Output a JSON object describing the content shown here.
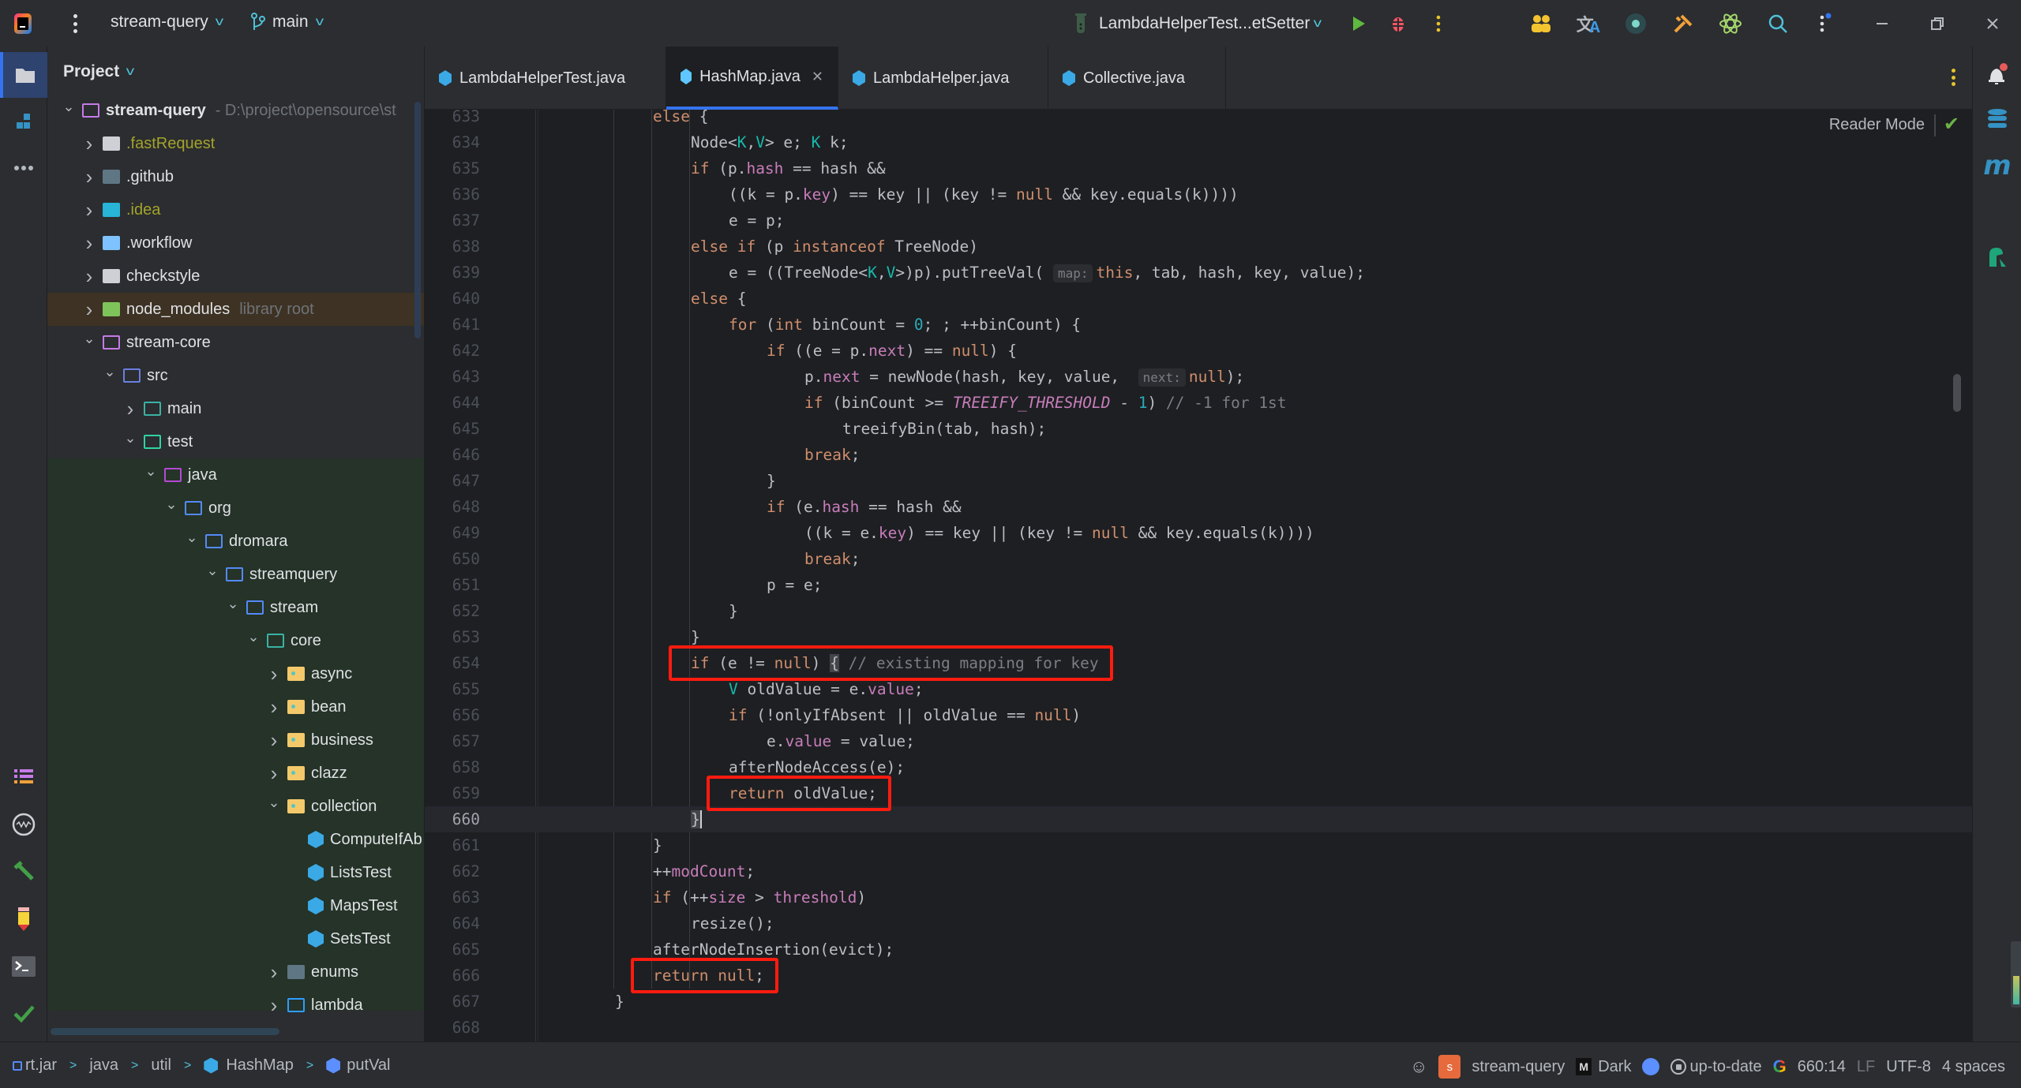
{
  "titlebar": {
    "project_name": "stream-query",
    "branch": "main",
    "run_config": "LambdaHelperTest...etSetter",
    "icons": [
      "app-logo-icon",
      "main-menu-icon",
      "run-icon",
      "debug-icon",
      "more-actions-icon",
      "code-with-me-icon",
      "translate-icon",
      "record-icon",
      "build-tools-icon",
      "ai-assistant-icon",
      "search-icon",
      "settings-more-icon",
      "minimize-icon",
      "restore-icon",
      "close-icon"
    ]
  },
  "left_toolbar": {
    "items": [
      {
        "name": "project-tool",
        "icon": "folder-icon",
        "active": true
      },
      {
        "name": "structure-tool",
        "icon": "structure-icon"
      },
      {
        "name": "more-tools",
        "icon": "more-horizontal-icon"
      },
      {
        "name": "todo-tool",
        "icon": "list-icon"
      },
      {
        "name": "profiler-tool",
        "icon": "waveform-icon"
      },
      {
        "name": "build-tool",
        "icon": "hammer-icon"
      },
      {
        "name": "notes-tool",
        "icon": "pencil-icon"
      },
      {
        "name": "terminal-tool",
        "icon": "terminal-icon"
      },
      {
        "name": "problems-tool",
        "icon": "check-icon"
      },
      {
        "name": "git-tool",
        "icon": "git-push-icon"
      }
    ]
  },
  "project_panel": {
    "title": "Project",
    "tree": [
      {
        "label": "stream-query",
        "hint": "- D:\\project\\opensource\\st",
        "depth": 0,
        "expanded": true,
        "icon": "module",
        "bold": true
      },
      {
        "label": ".fastRequest",
        "depth": 1,
        "expanded": false,
        "icon": "folder-solid",
        "olive": true
      },
      {
        "label": ".github",
        "depth": 1,
        "expanded": false,
        "icon": "folder-github"
      },
      {
        "label": ".idea",
        "depth": 1,
        "expanded": false,
        "icon": "folder-idea",
        "olive": true
      },
      {
        "label": ".workflow",
        "depth": 1,
        "expanded": false,
        "icon": "folder-workflow"
      },
      {
        "label": "checkstyle",
        "depth": 1,
        "expanded": false,
        "icon": "folder-solid"
      },
      {
        "label": "node_modules",
        "hint": "library root",
        "depth": 1,
        "expanded": false,
        "icon": "folder-node",
        "lib": true
      },
      {
        "label": "stream-core",
        "depth": 1,
        "expanded": true,
        "icon": "module"
      },
      {
        "label": "src",
        "depth": 2,
        "expanded": true,
        "icon": "folder-src"
      },
      {
        "label": "main",
        "depth": 3,
        "expanded": false,
        "icon": "folder-main"
      },
      {
        "label": "test",
        "depth": 3,
        "expanded": true,
        "icon": "folder-test"
      },
      {
        "label": "java",
        "depth": 4,
        "expanded": true,
        "icon": "folder-java"
      },
      {
        "label": "org",
        "depth": 5,
        "expanded": true,
        "icon": "package"
      },
      {
        "label": "dromara",
        "depth": 6,
        "expanded": true,
        "icon": "package"
      },
      {
        "label": "streamquery",
        "depth": 7,
        "expanded": true,
        "icon": "package"
      },
      {
        "label": "stream",
        "depth": 8,
        "expanded": true,
        "icon": "package"
      },
      {
        "label": "core",
        "depth": 9,
        "expanded": true,
        "icon": "folder-core"
      },
      {
        "label": "async",
        "depth": 10,
        "expanded": false,
        "icon": "package-yellow"
      },
      {
        "label": "bean",
        "depth": 10,
        "expanded": false,
        "icon": "package-yellow"
      },
      {
        "label": "business",
        "depth": 10,
        "expanded": false,
        "icon": "package-yellow"
      },
      {
        "label": "clazz",
        "depth": 10,
        "expanded": false,
        "icon": "package-yellow"
      },
      {
        "label": "collection",
        "depth": 10,
        "expanded": true,
        "icon": "package-yellow"
      },
      {
        "label": "ComputeIfAb",
        "depth": 11,
        "icon": "test-class"
      },
      {
        "label": "ListsTest",
        "depth": 11,
        "icon": "test-class"
      },
      {
        "label": "MapsTest",
        "depth": 11,
        "icon": "test-class"
      },
      {
        "label": "SetsTest",
        "depth": 11,
        "icon": "test-class"
      },
      {
        "label": "enums",
        "depth": 10,
        "expanded": false,
        "icon": "folder-enums"
      },
      {
        "label": "lambda",
        "depth": 10,
        "expanded": false,
        "icon": "folder-lambda"
      }
    ]
  },
  "editor": {
    "tabs": [
      {
        "label": "LambdaHelperTest.java",
        "active": false
      },
      {
        "label": "HashMap.java",
        "active": true,
        "closable": true
      },
      {
        "label": "LambdaHelper.java",
        "active": false
      },
      {
        "label": "Collective.java",
        "active": false
      }
    ],
    "reader_mode_label": "Reader Mode",
    "current_line": 660,
    "lines": [
      {
        "n": 633,
        "indent": 4,
        "html": "<span class='kw'>else</span> {"
      },
      {
        "n": 634,
        "indent": 5,
        "html": "Node&lt;<span class='tp'>K</span>,<span class='tp'>V</span>&gt; e; <span class='tp'>K</span> k;"
      },
      {
        "n": 635,
        "indent": 5,
        "html": "<span class='kw'>if</span> (p.<span class='fld'>hash</span> == hash &amp;&amp;"
      },
      {
        "n": 636,
        "indent": 6,
        "html": "((k = p.<span class='fld'>key</span>) == key || (key != <span class='kw'>null</span> &amp;&amp; key.equals(k))))"
      },
      {
        "n": 637,
        "indent": 6,
        "html": "e = p;"
      },
      {
        "n": 638,
        "indent": 5,
        "html": "<span class='kw'>else if</span> (p <span class='kw'>instanceof</span> TreeNode)"
      },
      {
        "n": 639,
        "indent": 6,
        "html": "e = ((TreeNode&lt;<span class='tp'>K</span>,<span class='tp'>V</span>&gt;)p).putTreeVal( <span class='hint'>map:</span><span class='kw'>this</span>, tab, hash, key, value);"
      },
      {
        "n": 640,
        "indent": 5,
        "html": "<span class='kw'>else</span> {"
      },
      {
        "n": 641,
        "indent": 6,
        "html": "<span class='kw'>for</span> (<span class='kw'>int</span> binCount = <span class='num'>0</span>; ; ++binCount) {"
      },
      {
        "n": 642,
        "indent": 7,
        "html": "<span class='kw'>if</span> ((e = p.<span class='fld'>next</span>) == <span class='kw'>null</span>) {"
      },
      {
        "n": 643,
        "indent": 8,
        "html": "p.<span class='fld'>next</span> = newNode(hash, key, value,  <span class='hint'>next:</span><span class='kw'>null</span>);"
      },
      {
        "n": 644,
        "indent": 8,
        "html": "<span class='kw'>if</span> (binCount &gt;= <span class='cst'>TREEIFY_THRESHOLD</span> - <span class='num'>1</span>) <span class='cmt'>// -1 for 1st</span>"
      },
      {
        "n": 645,
        "indent": 9,
        "html": "treeifyBin(tab, hash);"
      },
      {
        "n": 646,
        "indent": 8,
        "html": "<span class='kw'>break</span>;"
      },
      {
        "n": 647,
        "indent": 7,
        "html": "}"
      },
      {
        "n": 648,
        "indent": 7,
        "html": "<span class='kw'>if</span> (e.<span class='fld'>hash</span> == hash &amp;&amp;"
      },
      {
        "n": 649,
        "indent": 8,
        "html": "((k = e.<span class='fld'>key</span>) == key || (key != <span class='kw'>null</span> &amp;&amp; key.equals(k))))"
      },
      {
        "n": 650,
        "indent": 8,
        "html": "<span class='kw'>break</span>;"
      },
      {
        "n": 651,
        "indent": 7,
        "html": "p = e;"
      },
      {
        "n": 652,
        "indent": 6,
        "html": "}"
      },
      {
        "n": 653,
        "indent": 5,
        "html": "}"
      },
      {
        "n": 654,
        "indent": 5,
        "html": "<span class='kw'>if</span> (e != <span class='kw'>null</span>) <span class='brace-hl'>{</span> <span class='cmt'>// existing mapping for key</span>"
      },
      {
        "n": 655,
        "indent": 6,
        "html": "<span class='tp'>V</span> oldValue = e.<span class='fld'>value</span>;"
      },
      {
        "n": 656,
        "indent": 6,
        "html": "<span class='kw'>if</span> (!onlyIfAbsent || oldValue == <span class='kw'>null</span>)"
      },
      {
        "n": 657,
        "indent": 7,
        "html": "e.<span class='fld'>value</span> = value;"
      },
      {
        "n": 658,
        "indent": 6,
        "html": "afterNodeAccess(e);"
      },
      {
        "n": 659,
        "indent": 6,
        "html": "<span class='kw'>return</span> oldValue;"
      },
      {
        "n": 660,
        "indent": 5,
        "html": "<span class='brace-hl caret'>}</span>"
      },
      {
        "n": 661,
        "indent": 4,
        "html": "}"
      },
      {
        "n": 662,
        "indent": 4,
        "html": "++<span class='fld'>modCount</span>;"
      },
      {
        "n": 663,
        "indent": 4,
        "html": "<span class='kw'>if</span> (++<span class='fld'>size</span> &gt; <span class='fld'>threshold</span>)"
      },
      {
        "n": 664,
        "indent": 5,
        "html": "resize();"
      },
      {
        "n": 665,
        "indent": 4,
        "html": "afterNodeInsertion(evict);"
      },
      {
        "n": 666,
        "indent": 4,
        "html": "<span class='kw'>return</span> <span class='kw'>null</span>;"
      },
      {
        "n": 667,
        "indent": 3,
        "html": "}"
      },
      {
        "n": 668,
        "indent": 0,
        "html": ""
      }
    ],
    "highlights": [
      {
        "label": "if-e-not-null-box",
        "from_line": 654,
        "to_line": 654
      },
      {
        "label": "return-oldvalue-box",
        "from_line": 659,
        "to_line": 659
      },
      {
        "label": "return-null-box",
        "from_line": 666,
        "to_line": 666
      }
    ]
  },
  "right_toolbar": {
    "items": [
      "notifications-icon",
      "database-icon",
      "maven-icon",
      "fast-request-icon"
    ]
  },
  "statusbar": {
    "breadcrumbs": [
      "rt.jar",
      "java",
      "util",
      "HashMap",
      "putVal"
    ],
    "project": "stream-query",
    "project_badge": "s",
    "theme": "Dark",
    "vcs_status": "up-to-date",
    "cursor_position": "660:14",
    "line_separator": "LF",
    "encoding": "UTF-8",
    "indent": "4 spaces"
  }
}
